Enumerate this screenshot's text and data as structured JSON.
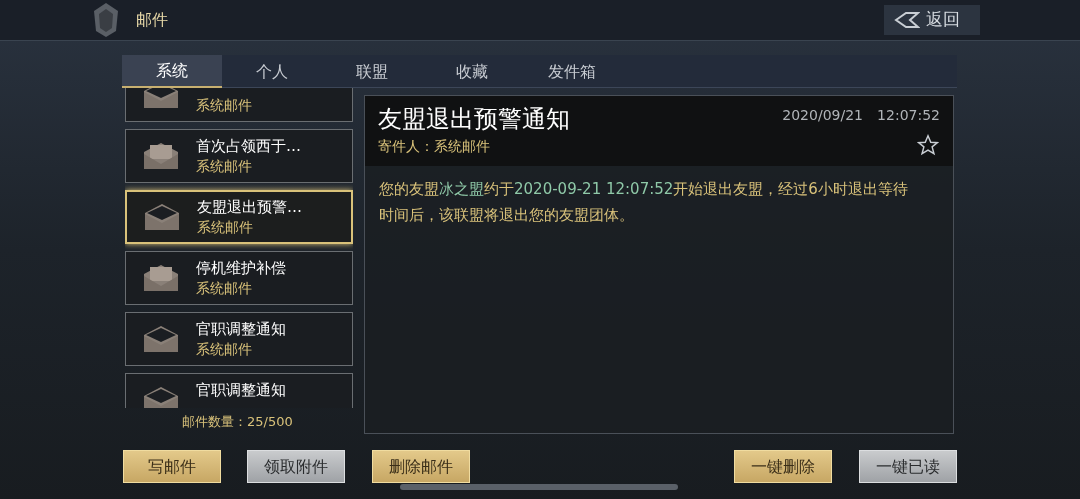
{
  "header": {
    "title": "邮件",
    "back": "返回"
  },
  "tabs": [
    {
      "label": "系统",
      "selected": true
    },
    {
      "label": "个人",
      "selected": false
    },
    {
      "label": "联盟",
      "selected": false
    },
    {
      "label": "收藏",
      "selected": false
    },
    {
      "label": "发件箱",
      "selected": false
    }
  ],
  "mails": [
    {
      "kind": "plain",
      "subtitle": "系统邮件",
      "selected": false
    },
    {
      "kind": "letter",
      "title": "首次占领西于…",
      "subtitle": "系统邮件",
      "selected": false
    },
    {
      "kind": "plain",
      "title": "友盟退出预警…",
      "subtitle": "系统邮件",
      "selected": true
    },
    {
      "kind": "letter",
      "title": "停机维护补偿",
      "subtitle": "系统邮件",
      "selected": false
    },
    {
      "kind": "plain",
      "title": "官职调整通知",
      "subtitle": "系统邮件",
      "selected": false
    },
    {
      "kind": "plain",
      "title": "官职调整通知",
      "selected": false
    }
  ],
  "mail_count": "邮件数量：25/500",
  "detail": {
    "title": "友盟退出预警通知",
    "sender": "寄件人：系统邮件",
    "date": "2020/09/21",
    "time": "12:07:52",
    "starred": false,
    "body": [
      {
        "text": "您的友盟",
        "highlight": false
      },
      {
        "text": "冰之盟",
        "highlight": true
      },
      {
        "text": "约于",
        "highlight": false
      },
      {
        "text": "2020-09-21 12:07:52",
        "highlight": true
      },
      {
        "text": "开始退出友盟，经过6小时退出等待时间后，该联盟将退出您的友盟团体。",
        "highlight": false
      }
    ]
  },
  "left_buttons": [
    {
      "label": "写邮件",
      "kind": "gold"
    },
    {
      "label": "领取附件",
      "kind": "gray"
    },
    {
      "label": "删除邮件",
      "kind": "gold"
    }
  ],
  "right_buttons": [
    {
      "label": "一键删除",
      "kind": "gold"
    },
    {
      "label": "一键已读",
      "kind": "gray"
    }
  ]
}
